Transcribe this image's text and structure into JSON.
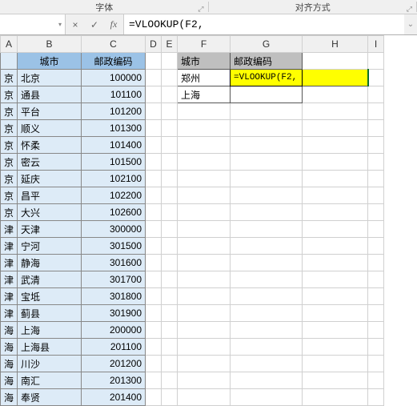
{
  "ribbon": {
    "font_section": "字体",
    "align_section": "对齐方式"
  },
  "formula_bar": {
    "name_box": "",
    "cancel_icon": "×",
    "confirm_icon": "✓",
    "fx_label": "fx",
    "formula": "=VLOOKUP(F2,"
  },
  "columns": [
    "A",
    "B",
    "C",
    "D",
    "E",
    "F",
    "G",
    "H",
    "I"
  ],
  "headers": {
    "city": "城市",
    "postal": "邮政编码"
  },
  "lookup": {
    "city_header": "城市",
    "postal_header": "邮政编码",
    "rows": [
      {
        "city": "郑州",
        "formula": "=VLOOKUP(F2,"
      },
      {
        "city": "上海",
        "formula": ""
      }
    ]
  },
  "table": [
    {
      "prov": "京",
      "city": "北京",
      "postal": "100000"
    },
    {
      "prov": "京",
      "city": "通县",
      "postal": "101100"
    },
    {
      "prov": "京",
      "city": "平台",
      "postal": "101200"
    },
    {
      "prov": "京",
      "city": "顺义",
      "postal": "101300"
    },
    {
      "prov": "京",
      "city": "怀柔",
      "postal": "101400"
    },
    {
      "prov": "京",
      "city": "密云",
      "postal": "101500"
    },
    {
      "prov": "京",
      "city": "延庆",
      "postal": "102100"
    },
    {
      "prov": "京",
      "city": "昌平",
      "postal": "102200"
    },
    {
      "prov": "京",
      "city": "大兴",
      "postal": "102600"
    },
    {
      "prov": "津",
      "city": "天津",
      "postal": "300000"
    },
    {
      "prov": "津",
      "city": "宁河",
      "postal": "301500"
    },
    {
      "prov": "津",
      "city": "静海",
      "postal": "301600"
    },
    {
      "prov": "津",
      "city": "武清",
      "postal": "301700"
    },
    {
      "prov": "津",
      "city": "宝坻",
      "postal": "301800"
    },
    {
      "prov": "津",
      "city": "蓟县",
      "postal": "301900"
    },
    {
      "prov": "海",
      "city": "上海",
      "postal": "200000"
    },
    {
      "prov": "海",
      "city": "上海县",
      "postal": "201100"
    },
    {
      "prov": "海",
      "city": "川沙",
      "postal": "201200"
    },
    {
      "prov": "海",
      "city": "南汇",
      "postal": "201300"
    },
    {
      "prov": "海",
      "city": "奉贤",
      "postal": "201400"
    }
  ]
}
